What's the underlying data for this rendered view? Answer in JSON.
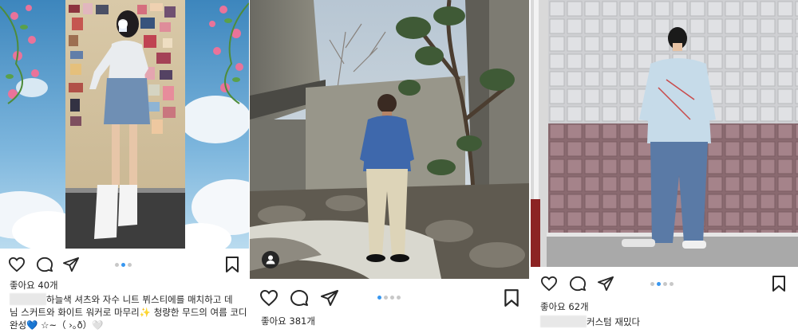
{
  "posts": [
    {
      "likes": "좋아요 40개",
      "caption_line1": "하늘색 셔츠와 자수 니트 뷔스티에를 매치하고 데",
      "caption_line2": "님 스커트와 화이트 워커로 마무리✨ 청량한 무드의 여름 코디",
      "caption_line3": "완성💙 ☆~（ ›｡ð）🤍",
      "carousel": {
        "count": 3,
        "active": 1
      }
    },
    {
      "likes": "좋아요 381개",
      "carousel": {
        "count": 4,
        "active": 0
      }
    },
    {
      "likes": "좋아요 62개",
      "caption_line1": "커스텀 재밌다",
      "carousel": {
        "count": 4,
        "active": 1
      }
    }
  ],
  "icons": [
    "heart-icon",
    "comment-icon",
    "share-icon",
    "bookmark-icon",
    "user-tag-icon"
  ],
  "colors": {
    "accent_dot": "#3897f0",
    "inactive_dot": "#c8c8c8",
    "text": "#262626"
  }
}
